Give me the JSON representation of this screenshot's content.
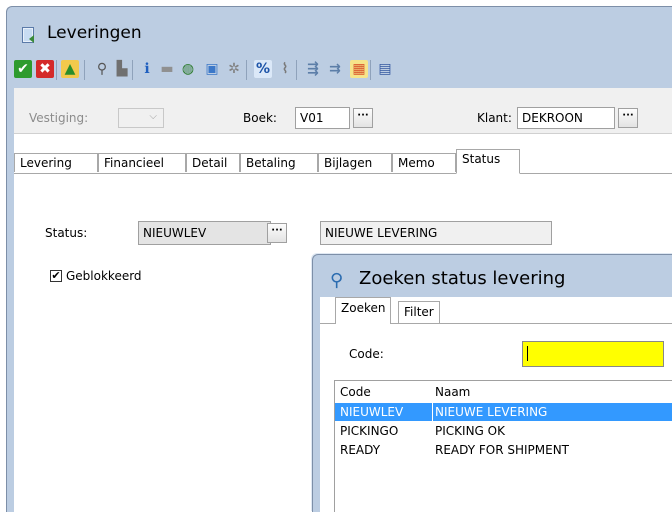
{
  "window": {
    "title": "Leveringen"
  },
  "toolbar": {
    "buttons": [
      {
        "name": "accept-icon",
        "glyph": "✔",
        "color": "#ffffff",
        "bg": "#2e9b2e"
      },
      {
        "name": "cancel-icon",
        "glyph": "✖",
        "color": "#ffffff",
        "bg": "#d42a2a"
      },
      {
        "name": "upload-icon",
        "glyph": "▲",
        "color": "#2a8d2a",
        "bg": "#f2c94c"
      },
      {
        "name": "search-icon",
        "glyph": "⚲",
        "color": "#555555",
        "bg": ""
      },
      {
        "name": "stamp-icon",
        "glyph": "▙",
        "color": "#707070",
        "bg": ""
      },
      {
        "name": "info-icon",
        "glyph": "ℹ",
        "color": "#1f5fbf",
        "bg": ""
      },
      {
        "name": "bar-icon",
        "glyph": "▬",
        "color": "#909090",
        "bg": ""
      },
      {
        "name": "globe-icon",
        "glyph": "◍",
        "color": "#2b7a2b",
        "bg": ""
      },
      {
        "name": "image-icon",
        "glyph": "▣",
        "color": "#3c78c8",
        "bg": ""
      },
      {
        "name": "gear-icon",
        "glyph": "✲",
        "color": "#808080",
        "bg": ""
      },
      {
        "name": "percent-icon",
        "glyph": "%",
        "color": "#1d54a8",
        "bg": "#dbe8f8"
      },
      {
        "name": "paperclip-icon",
        "glyph": "⌇",
        "color": "#7a7a7a",
        "bg": ""
      },
      {
        "name": "tree-icon",
        "glyph": "⇶",
        "color": "#5c7ea8",
        "bg": ""
      },
      {
        "name": "flow-icon",
        "glyph": "⇉",
        "color": "#5c7ea8",
        "bg": ""
      },
      {
        "name": "grid-icon",
        "glyph": "▦",
        "color": "#d8542b",
        "bg": "#f6e48a"
      },
      {
        "name": "save-icon",
        "glyph": "▤",
        "color": "#3559a0",
        "bg": ""
      }
    ]
  },
  "header": {
    "vestiging_label": "Vestiging:",
    "vestiging_value": "",
    "boek_label": "Boek:",
    "boek_value": "V01",
    "klant_label": "Klant:",
    "klant_value": "DEKROON",
    "lookup_glyph": "···"
  },
  "tabs": [
    {
      "label": "Levering"
    },
    {
      "label": "Financieel"
    },
    {
      "label": "Detail"
    },
    {
      "label": "Betaling"
    },
    {
      "label": "Bijlagen"
    },
    {
      "label": "Memo"
    },
    {
      "label": "Status"
    }
  ],
  "status_tab": {
    "status_label": "Status:",
    "status_code": "NIEUWLEV",
    "status_description": "NIEUWE LEVERING",
    "blocked_label": "Geblokkeerd",
    "blocked_checked": true
  },
  "dialog": {
    "title": "Zoeken status levering",
    "tabs": [
      {
        "label": "Zoeken"
      },
      {
        "label": "Filter"
      }
    ],
    "code_label": "Code:",
    "code_value": "",
    "columns": [
      "Code",
      "Naam"
    ],
    "rows": [
      {
        "code": "NIEUWLEV",
        "naam": "NIEUWE LEVERING",
        "selected": true
      },
      {
        "code": "PICKINGO",
        "naam": "PICKING OK",
        "selected": false
      },
      {
        "code": "READY",
        "naam": "READY FOR SHIPMENT",
        "selected": false
      }
    ],
    "highlight_color": "#3399ff",
    "input_color": "#ffff00"
  }
}
